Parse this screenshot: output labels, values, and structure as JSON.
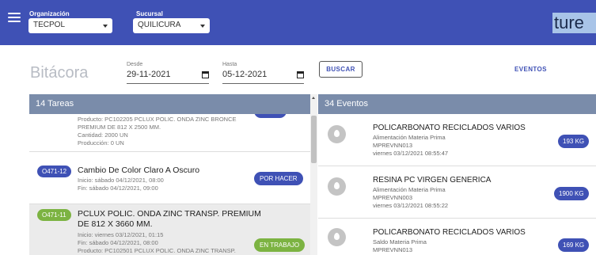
{
  "header": {
    "org_label": "Organización",
    "org_value": "TECPOL",
    "branch_label": "Sucursal",
    "branch_value": "QUILICURA",
    "brand_text": "ture"
  },
  "toolbar": {
    "title": "Bitácora",
    "from_label": "Desde",
    "from_value": "29-11-2021",
    "to_label": "Hasta",
    "to_value": "05-12-2021",
    "search_label": "BUSCAR",
    "events_link": "EVENTOS"
  },
  "tasks_panel": {
    "header": "14 Tareas",
    "items": [
      {
        "code": "",
        "title": "",
        "lines": [
          "Producto: PC102205 PCLUX POLIC. ONDA ZINC BRONCE",
          "PREMIUM DE 812 X 2500 MM.",
          "Cantidad: 2000 UN",
          "Producción: 0 UN"
        ],
        "status": ""
      },
      {
        "code": "O471-12",
        "title": "Cambio De Color Claro A Oscuro",
        "lines": [
          "Inicio: sábado 04/12/2021, 08:00",
          "Fin: sábado 04/12/2021, 09:00"
        ],
        "status": "POR HACER"
      },
      {
        "code": "O471-11",
        "title_line1": "PCLUX POLIC. ONDA ZINC TRANSP. PREMIUM",
        "title_line2": "DE 812 X 3660 MM.",
        "lines": [
          "Inicio: viernes 03/12/2021, 01:15",
          "Fin: sábado 04/12/2021, 08:00",
          "Producto: PC102501 PCLUX POLIC. ONDA ZINC TRANSP."
        ],
        "status": "EN TRABAJO"
      }
    ]
  },
  "events_panel": {
    "header": "34 Eventos",
    "items": [
      {
        "title": "POLICARBONATO RECICLADOS VARIOS",
        "type": "Alimentación Materia Prima",
        "code": "MPREVNN013",
        "date": "viernes 03/12/2021 08:55:47",
        "qty": "193 KG"
      },
      {
        "title": "RESINA PC VIRGEN GENERICA",
        "type": "Alimentación Materia Prima",
        "code": "MPREVNN003",
        "date": "viernes 03/12/2021 08:55:22",
        "qty": "1900 KG"
      },
      {
        "title": "POLICARBONATO RECICLADOS VARIOS",
        "type": "Saldo Materia Prima",
        "code": "MPREVNN013",
        "date": "",
        "qty": "169 KG"
      }
    ]
  },
  "colors": {
    "primary": "#3f51b5",
    "panel_header": "#7a8caa",
    "todo_pill": "#3f51b5",
    "working_pill": "#7cb342",
    "qty_pill": "#3f51b5"
  }
}
